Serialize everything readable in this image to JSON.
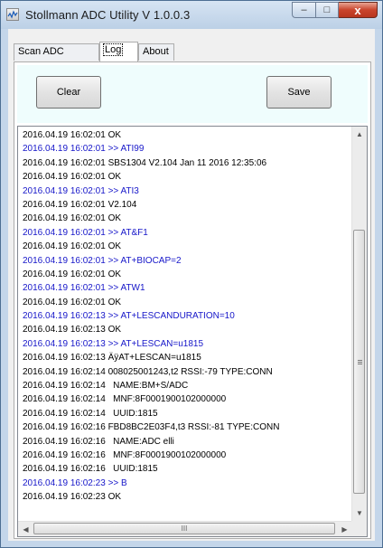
{
  "window": {
    "title": "Stollmann ADC  Utility V 1.0.0.3",
    "icon": "app-icon",
    "controls": {
      "minimize": "–",
      "maximize": "□",
      "close": "x"
    }
  },
  "tabs": [
    {
      "label": "Scan ADC devices",
      "active": false
    },
    {
      "label": "Log",
      "active": true
    },
    {
      "label": "About",
      "active": false
    }
  ],
  "buttons": {
    "clear": "Clear",
    "save": "Save"
  },
  "log": {
    "lines": [
      {
        "date": "2016.04.19",
        "time": "16:02:01",
        "text": "OK",
        "kind": "response"
      },
      {
        "date": "2016.04.19",
        "time": "16:02:01",
        "text": ">> ATI99",
        "kind": "command"
      },
      {
        "date": "2016.04.19",
        "time": "16:02:01",
        "text": "SBS1304 V2.104 Jan 11 2016 12:35:06",
        "kind": "response"
      },
      {
        "date": "2016.04.19",
        "time": "16:02:01",
        "text": "OK",
        "kind": "response"
      },
      {
        "date": "2016.04.19",
        "time": "16:02:01",
        "text": ">> ATI3",
        "kind": "command"
      },
      {
        "date": "2016.04.19",
        "time": "16:02:01",
        "text": "V2.104",
        "kind": "response"
      },
      {
        "date": "2016.04.19",
        "time": "16:02:01",
        "text": "OK",
        "kind": "response"
      },
      {
        "date": "2016.04.19",
        "time": "16:02:01",
        "text": ">> AT&F1",
        "kind": "command"
      },
      {
        "date": "2016.04.19",
        "time": "16:02:01",
        "text": "OK",
        "kind": "response"
      },
      {
        "date": "2016.04.19",
        "time": "16:02:01",
        "text": ">> AT+BIOCAP=2",
        "kind": "command"
      },
      {
        "date": "2016.04.19",
        "time": "16:02:01",
        "text": "OK",
        "kind": "response"
      },
      {
        "date": "2016.04.19",
        "time": "16:02:01",
        "text": ">> ATW1",
        "kind": "command"
      },
      {
        "date": "2016.04.19",
        "time": "16:02:01",
        "text": "OK",
        "kind": "response"
      },
      {
        "date": "2016.04.19",
        "time": "16:02:13",
        "text": ">> AT+LESCANDURATION=10",
        "kind": "command"
      },
      {
        "date": "2016.04.19",
        "time": "16:02:13",
        "text": "OK",
        "kind": "response"
      },
      {
        "date": "2016.04.19",
        "time": "16:02:13",
        "text": ">> AT+LESCAN=u1815",
        "kind": "command"
      },
      {
        "date": "2016.04.19",
        "time": "16:02:13",
        "text": "ÄÿAT+LESCAN=u1815",
        "kind": "response"
      },
      {
        "date": "2016.04.19",
        "time": "16:02:14",
        "text": "008025001243,t2 RSSI:-79 TYPE:CONN",
        "kind": "response"
      },
      {
        "date": "2016.04.19",
        "time": "16:02:14",
        "text": "  NAME:BM+S/ADC",
        "kind": "response"
      },
      {
        "date": "2016.04.19",
        "time": "16:02:14",
        "text": "  MNF:8F0001900102000000",
        "kind": "response"
      },
      {
        "date": "2016.04.19",
        "time": "16:02:14",
        "text": "  UUID:1815",
        "kind": "response"
      },
      {
        "date": "2016.04.19",
        "time": "16:02:16",
        "text": "FBD8BC2E03F4,t3 RSSI:-81 TYPE:CONN",
        "kind": "response"
      },
      {
        "date": "2016.04.19",
        "time": "16:02:16",
        "text": "  NAME:ADC elli",
        "kind": "response"
      },
      {
        "date": "2016.04.19",
        "time": "16:02:16",
        "text": "  MNF:8F0001900102000000",
        "kind": "response"
      },
      {
        "date": "2016.04.19",
        "time": "16:02:16",
        "text": "  UUID:1815",
        "kind": "response"
      },
      {
        "date": "2016.04.19",
        "time": "16:02:23",
        "text": ">> B",
        "kind": "command"
      },
      {
        "date": "2016.04.19",
        "time": "16:02:23",
        "text": "OK",
        "kind": "response"
      }
    ]
  },
  "scrollbars": {
    "vertical": {
      "up": "▲",
      "down": "▼",
      "grip": "≡"
    },
    "horizontal": {
      "left": "◀",
      "right": "▶",
      "grip": "III"
    }
  },
  "colors": {
    "command_text": "#1616c9",
    "response_text": "#000000",
    "button_area_bg": "#effdfd",
    "close_button": "#c9442c"
  }
}
